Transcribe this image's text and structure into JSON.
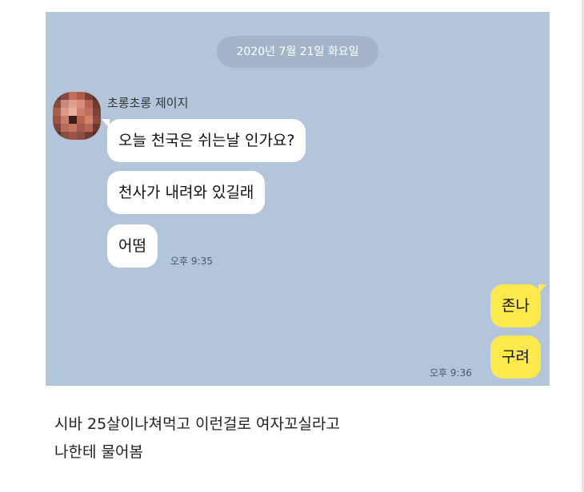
{
  "chat": {
    "date": "2020년 7월 21일 화요일",
    "sender": "초롱초롱 제이지",
    "incoming": [
      {
        "text": "오늘 천국은 쉬는날 인가요?"
      },
      {
        "text": "천사가 내려와 있길래"
      },
      {
        "text": "어떰"
      }
    ],
    "incoming_time": "오후 9:35",
    "outgoing": [
      {
        "text": "존나"
      },
      {
        "text": "구려"
      }
    ],
    "outgoing_time": "오후 9:36"
  },
  "caption": {
    "line1": "시바 25살이나쳐먹고 이런걸로 여자꼬실라고",
    "line2": "나한테 물어봄"
  },
  "colors": {
    "chat_background": "#b2c5da",
    "outgoing_bubble": "#fce94c",
    "incoming_bubble": "#ffffff",
    "date_pill": "#a3b4c8"
  },
  "icons": {
    "avatar": "pixelated-profile-photo"
  }
}
